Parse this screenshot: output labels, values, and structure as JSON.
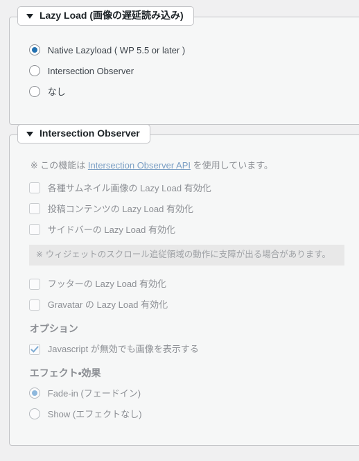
{
  "page": {
    "background_color": "#f0f0f1",
    "panel_background": "#f6f7f7",
    "panel_border": "#c3c4c7",
    "accent_color": "#2271b1",
    "link_color": "#7b9fc4",
    "disabled_text_color": "#8c8f94"
  },
  "lazy_load_panel": {
    "legend": "Lazy Load (画像の遅延読み込み)",
    "caret_icon": "triangle-down-icon",
    "options": [
      {
        "label": "Native Lazyload ( WP 5.5 or later )",
        "selected": true,
        "disabled": false
      },
      {
        "label": "Intersection Observer",
        "selected": false,
        "disabled": false
      },
      {
        "label": "なし",
        "selected": false,
        "disabled": false
      }
    ]
  },
  "intersection_observer_panel": {
    "legend": "Intersection Observer",
    "caret_icon": "triangle-down-icon",
    "note": {
      "prefix": "※ この機能は ",
      "link_text": "Intersection Observer API",
      "suffix": " を使用しています。"
    },
    "checkboxes_top": [
      {
        "label": "各種サムネイル画像の Lazy Load 有効化",
        "checked": false,
        "disabled": true
      },
      {
        "label": "投稿コンテンツの Lazy Load 有効化",
        "checked": false,
        "disabled": true
      },
      {
        "label": "サイドバーの Lazy Load 有効化",
        "checked": false,
        "disabled": true
      }
    ],
    "grey_notice": "※ ウィジェットのスクロール追従領域の動作に支障が出る場合があります。",
    "checkboxes_bottom": [
      {
        "label": "フッターの Lazy Load 有効化",
        "checked": false,
        "disabled": true
      },
      {
        "label": "Gravatar の Lazy Load 有効化",
        "checked": false,
        "disabled": true
      }
    ],
    "options_heading": "オプション",
    "options_checkboxes": [
      {
        "label": "Javascript が無効でも画像を表示する",
        "checked": true,
        "disabled": true
      }
    ],
    "effect_heading": "エフェクト・効果",
    "effect_options": [
      {
        "label": "Fade-in (フェードイン)",
        "selected": true,
        "disabled": true
      },
      {
        "label": "Show (エフェクトなし)",
        "selected": false,
        "disabled": true
      }
    ]
  }
}
